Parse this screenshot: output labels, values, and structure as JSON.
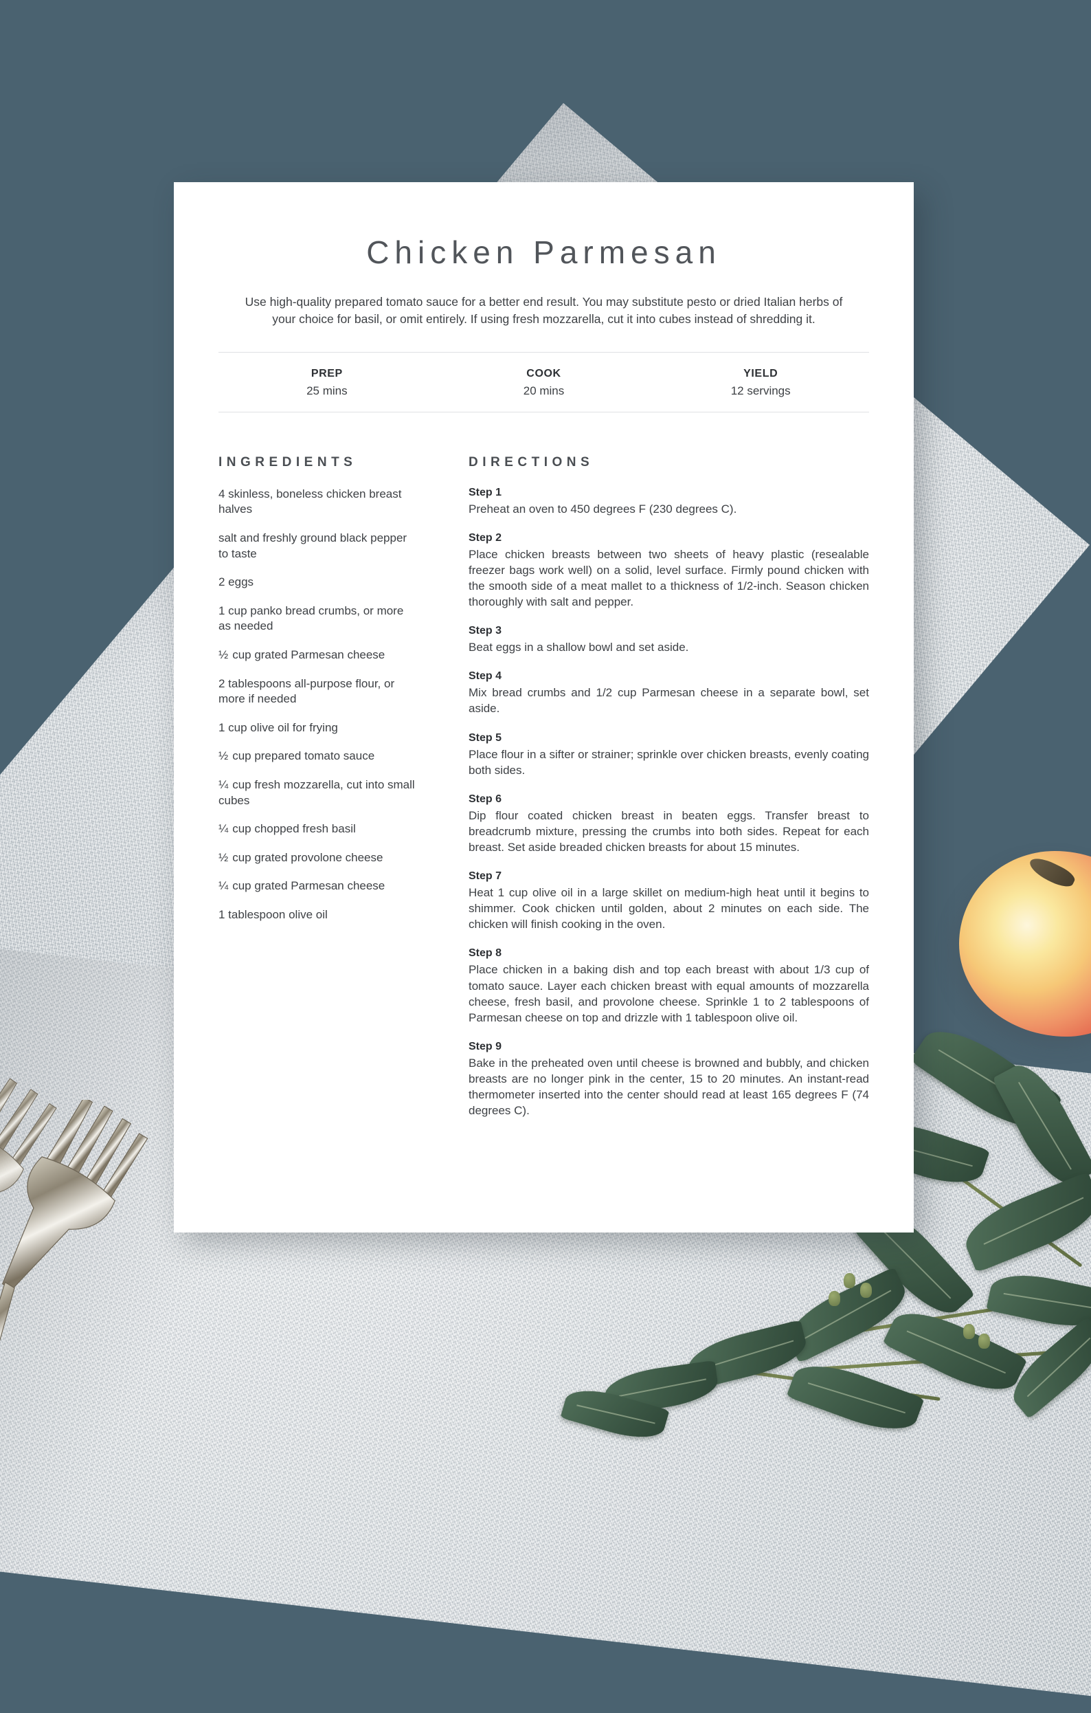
{
  "colors": {
    "backdrop": "#4a6270",
    "card": "#ffffff",
    "title_text": "#51555a",
    "body_text": "#3e4145",
    "heading_text": "#2d3034",
    "divider": "#dfe1e3"
  },
  "recipe": {
    "title": "Chicken Parmesan",
    "description": "Use high-quality prepared tomato sauce for a better end result. You may substitute pesto or dried Italian herbs of your choice for basil, or omit entirely. If using fresh mozzarella, cut it into cubes instead of shredding it.",
    "stats": [
      {
        "label": "PREP",
        "value": "25 mins"
      },
      {
        "label": "COOK",
        "value": "20 mins"
      },
      {
        "label": "YIELD",
        "value": "12 servings"
      }
    ],
    "ingredients_heading": "INGREDIENTS",
    "ingredients": [
      {
        "fraction": "",
        "text": "4 skinless, boneless chicken breast halves"
      },
      {
        "fraction": "",
        "text": "salt and freshly ground black pepper to taste"
      },
      {
        "fraction": "",
        "text": "2 eggs"
      },
      {
        "fraction": "",
        "text": "1 cup panko bread crumbs, or more as needed"
      },
      {
        "fraction": "½",
        "text": "cup grated Parmesan cheese"
      },
      {
        "fraction": "",
        "text": "2 tablespoons all-purpose flour, or more if needed"
      },
      {
        "fraction": "",
        "text": "1 cup olive oil for frying"
      },
      {
        "fraction": "½",
        "text": "cup prepared tomato sauce"
      },
      {
        "fraction": "¼",
        "text": "cup fresh mozzarella, cut into small cubes"
      },
      {
        "fraction": "¼",
        "text": "cup chopped fresh basil"
      },
      {
        "fraction": "½",
        "text": "cup grated provolone cheese"
      },
      {
        "fraction": "¼",
        "text": "cup grated Parmesan cheese"
      },
      {
        "fraction": "",
        "text": "1 tablespoon olive oil"
      }
    ],
    "directions_heading": "DIRECTIONS",
    "directions": [
      {
        "label": "Step 1",
        "text": "Preheat an oven to 450 degrees F (230 degrees C)."
      },
      {
        "label": "Step 2",
        "text": "Place chicken breasts between two sheets of heavy plastic (resealable freezer bags work well) on a solid, level surface. Firmly pound chicken with the smooth side of a meat mallet to a thickness of 1/2-inch. Season chicken thoroughly with salt and pepper."
      },
      {
        "label": "Step 3",
        "text": "Beat eggs in a shallow bowl and set aside."
      },
      {
        "label": "Step 4",
        "text": "Mix bread crumbs and 1/2 cup Parmesan cheese in a separate bowl, set aside."
      },
      {
        "label": "Step 5",
        "text": "Place flour in a sifter or strainer; sprinkle over chicken breasts, evenly coating both sides."
      },
      {
        "label": "Step 6",
        "text": "Dip flour coated chicken breast in beaten eggs. Transfer breast to breadcrumb mixture, pressing the crumbs into both sides. Repeat for each breast. Set aside breaded chicken breasts for about 15 minutes."
      },
      {
        "label": "Step 7",
        "text": "Heat 1 cup olive oil in a large skillet on medium-high heat until it begins to shimmer. Cook chicken until golden, about 2 minutes on each side. The chicken will finish cooking in the oven."
      },
      {
        "label": "Step 8",
        "text": "Place chicken in a baking dish and top each breast with about 1/3 cup of tomato sauce. Layer each chicken breast with equal amounts of mozzarella cheese, fresh basil, and provolone cheese. Sprinkle 1 to 2 tablespoons of Parmesan cheese on top and drizzle with 1 tablespoon olive oil."
      },
      {
        "label": "Step 9",
        "text": "Bake in the preheated oven until cheese is browned and bubbly, and chicken breasts are no longer pink in the center, 15 to 20 minutes. An instant-read thermometer inserted into the center should read at least 165 degrees F (74 degrees C)."
      }
    ]
  },
  "scene": {
    "props": [
      "concrete-slab",
      "vintage-fork",
      "apple",
      "eucalyptus-branch"
    ]
  }
}
